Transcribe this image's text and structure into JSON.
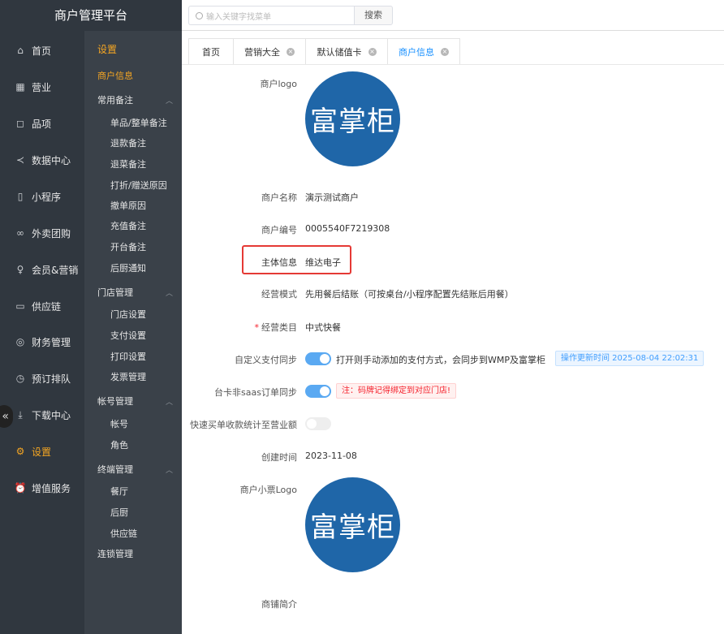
{
  "app": {
    "title": "商户管理平台"
  },
  "search": {
    "placeholder": "输入关键字找菜单",
    "button": "搜索"
  },
  "nav": [
    {
      "label": "首页",
      "icon": "home-icon",
      "glyph": "⌂"
    },
    {
      "label": "营业",
      "icon": "calendar-icon",
      "glyph": "▦"
    },
    {
      "label": "品项",
      "icon": "bag-icon",
      "glyph": "◻"
    },
    {
      "label": "数据中心",
      "icon": "share-icon",
      "glyph": "≺"
    },
    {
      "label": "小程序",
      "icon": "phone-icon",
      "glyph": "▯"
    },
    {
      "label": "外卖团购",
      "icon": "bike-icon",
      "glyph": "∞"
    },
    {
      "label": "会员&营销",
      "icon": "user-icon",
      "glyph": "♀"
    },
    {
      "label": "供应链",
      "icon": "truck-icon",
      "glyph": "▭"
    },
    {
      "label": "财务管理",
      "icon": "database-icon",
      "glyph": "◎"
    },
    {
      "label": "预订排队",
      "icon": "clock-icon",
      "glyph": "◷"
    },
    {
      "label": "下载中心",
      "icon": "download-icon",
      "glyph": "⤓"
    },
    {
      "label": "设置",
      "icon": "gear-icon",
      "glyph": "⚙"
    },
    {
      "label": "增值服务",
      "icon": "alarm-icon",
      "glyph": "⏰"
    }
  ],
  "subnav": {
    "title": "设置",
    "merchant_info": "商户信息",
    "groups": [
      {
        "label": "常用备注",
        "items": [
          "单品/整单备注",
          "退款备注",
          "退菜备注",
          "打折/赠送原因",
          "撤单原因",
          "充值备注",
          "开台备注",
          "后厨通知"
        ]
      },
      {
        "label": "门店管理",
        "items": [
          "门店设置",
          "支付设置",
          "打印设置",
          "发票管理"
        ]
      },
      {
        "label": "帐号管理",
        "items": [
          "帐号",
          "角色"
        ]
      },
      {
        "label": "终端管理",
        "items": [
          "餐厅",
          "后厨",
          "供应链"
        ]
      }
    ],
    "chain": "连锁管理"
  },
  "tabs": [
    {
      "label": "首页"
    },
    {
      "label": "营销大全"
    },
    {
      "label": "默认储值卡"
    },
    {
      "label": "商户信息"
    }
  ],
  "form": {
    "logo_label": "商户logo",
    "logo_text": "富掌柜",
    "name_label": "商户名称",
    "name": "演示测试商户",
    "code_label": "商户编号",
    "code": "0005540F7219308",
    "entity_label": "主体信息",
    "entity": "维达电子",
    "mode_label": "经营模式",
    "mode": "先用餐后结账（可按桌台/小程序配置先结账后用餐）",
    "category_label": "经营类目",
    "category_required": "*",
    "category": "中式快餐",
    "custom_pay_label": "自定义支付同步",
    "custom_pay_desc": "打开则手动添加的支付方式，会同步到WMP及富掌柜",
    "custom_pay_tag": "操作更新时间 2025-08-04 22:02:31",
    "custom_pay_on": true,
    "saas_label": "台卡非saas订单同步",
    "saas_tag": "注：码牌记得绑定到对应门店!",
    "saas_on": true,
    "fast_label": "快速买单收款统计至营业额",
    "fast_on": false,
    "created_label": "创建时间",
    "created": "2023-11-08",
    "receipt_logo_label": "商户小票Logo",
    "receipt_logo_text": "富掌柜",
    "intro_label": "商铺简介"
  },
  "colors": {
    "sidebar": "#30373f",
    "subnav": "#3a4149",
    "accent": "#f5a623",
    "primary": "#1890ff",
    "logo": "#1f66a8"
  }
}
